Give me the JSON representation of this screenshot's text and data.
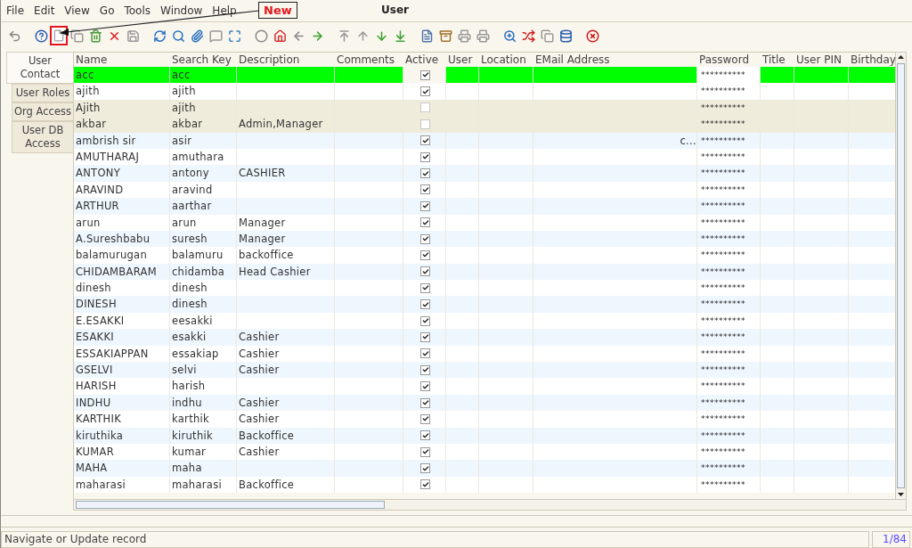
{
  "menu": [
    {
      "label": "File"
    },
    {
      "label": "Edit"
    },
    {
      "label": "View"
    },
    {
      "label": "Go"
    },
    {
      "label": "Tools"
    },
    {
      "label": "Window"
    },
    {
      "label": "Help"
    }
  ],
  "window": {
    "title": "User"
  },
  "annotation": {
    "label": "New"
  },
  "tabs": [
    {
      "label": "User Contact",
      "selected": true
    },
    {
      "label": "User Roles",
      "selected": false
    },
    {
      "label": "Org Access",
      "selected": false
    },
    {
      "label": "User DB Access",
      "selected": false
    }
  ],
  "table": {
    "columns": [
      "Name",
      "Search Key",
      "Description",
      "Comments",
      "Active",
      "User",
      "Location",
      "EMail Address",
      "Password",
      "Title",
      "User PIN",
      "Birthday"
    ],
    "rows": [
      {
        "name": "acc",
        "key": "acc",
        "description": "",
        "active": true,
        "selected": true,
        "email": "",
        "password": "**********"
      },
      {
        "name": "ajith",
        "key": "ajith",
        "description": "",
        "active": true,
        "selected": false,
        "email": "",
        "password": "**********"
      },
      {
        "name": "Ajith",
        "key": "ajith",
        "description": "",
        "active": false,
        "selected": false,
        "email": "",
        "password": "**********"
      },
      {
        "name": "akbar",
        "key": "akbar",
        "description": "Admin,Manager",
        "active": false,
        "selected": false,
        "email": "",
        "password": "**********"
      },
      {
        "name": "ambrish sir",
        "key": "asir",
        "description": "",
        "active": true,
        "selected": false,
        "email": "c...",
        "password": "**********"
      },
      {
        "name": "AMUTHARAJ",
        "key": "amuthara",
        "description": "",
        "active": true,
        "selected": false,
        "email": "",
        "password": "**********"
      },
      {
        "name": "ANTONY",
        "key": "antony",
        "description": "CASHIER",
        "active": true,
        "selected": false,
        "email": "",
        "password": "**********"
      },
      {
        "name": "ARAVIND",
        "key": "aravind",
        "description": "",
        "active": true,
        "selected": false,
        "email": "",
        "password": "**********"
      },
      {
        "name": "ARTHUR",
        "key": "aarthar",
        "description": "",
        "active": true,
        "selected": false,
        "email": "",
        "password": "**********"
      },
      {
        "name": "arun",
        "key": "arun",
        "description": "Manager",
        "active": true,
        "selected": false,
        "email": "",
        "password": "**********"
      },
      {
        "name": "A.Sureshbabu",
        "key": "suresh",
        "description": "Manager",
        "active": true,
        "selected": false,
        "email": "",
        "password": "**********"
      },
      {
        "name": "balamurugan",
        "key": "balamuru",
        "description": "backoffice",
        "active": true,
        "selected": false,
        "email": "",
        "password": "**********"
      },
      {
        "name": "CHIDAMBARAM",
        "key": "chidamba",
        "description": "Head Cashier",
        "active": true,
        "selected": false,
        "email": "",
        "password": "**********"
      },
      {
        "name": "dinesh",
        "key": "dinesh",
        "description": "",
        "active": true,
        "selected": false,
        "email": "",
        "password": "**********"
      },
      {
        "name": "DINESH",
        "key": "dinesh",
        "description": "",
        "active": true,
        "selected": false,
        "email": "",
        "password": "**********"
      },
      {
        "name": "E.ESAKKI",
        "key": "eesakki",
        "description": "",
        "active": true,
        "selected": false,
        "email": "",
        "password": "**********"
      },
      {
        "name": "ESAKKI",
        "key": "esakki",
        "description": "Cashier",
        "active": true,
        "selected": false,
        "email": "",
        "password": "**********"
      },
      {
        "name": "ESSAKIAPPAN",
        "key": "essakiap",
        "description": "Cashier",
        "active": true,
        "selected": false,
        "email": "",
        "password": "**********"
      },
      {
        "name": "GSELVI",
        "key": "selvi",
        "description": "Cashier",
        "active": true,
        "selected": false,
        "email": "",
        "password": "**********"
      },
      {
        "name": "HARISH",
        "key": "harish",
        "description": "",
        "active": true,
        "selected": false,
        "email": "",
        "password": "**********"
      },
      {
        "name": "INDHU",
        "key": "indhu",
        "description": "Cashier",
        "active": true,
        "selected": false,
        "email": "",
        "password": "**********"
      },
      {
        "name": "KARTHIK",
        "key": "karthik",
        "description": "Cashier",
        "active": true,
        "selected": false,
        "email": "",
        "password": "**********"
      },
      {
        "name": "kiruthika",
        "key": "kiruthik",
        "description": "Backoffice",
        "active": true,
        "selected": false,
        "email": "",
        "password": "**********"
      },
      {
        "name": "KUMAR",
        "key": "kumar",
        "description": "Cashier",
        "active": true,
        "selected": false,
        "email": "",
        "password": "**********"
      },
      {
        "name": "MAHA",
        "key": "maha",
        "description": "",
        "active": true,
        "selected": false,
        "email": "",
        "password": "**********"
      },
      {
        "name": "maharasi",
        "key": "maharasi",
        "description": "Backoffice",
        "active": true,
        "selected": false,
        "email": "",
        "password": "**********"
      }
    ]
  },
  "status_bar": {
    "message": "Navigate or Update record",
    "record": "1/84"
  }
}
